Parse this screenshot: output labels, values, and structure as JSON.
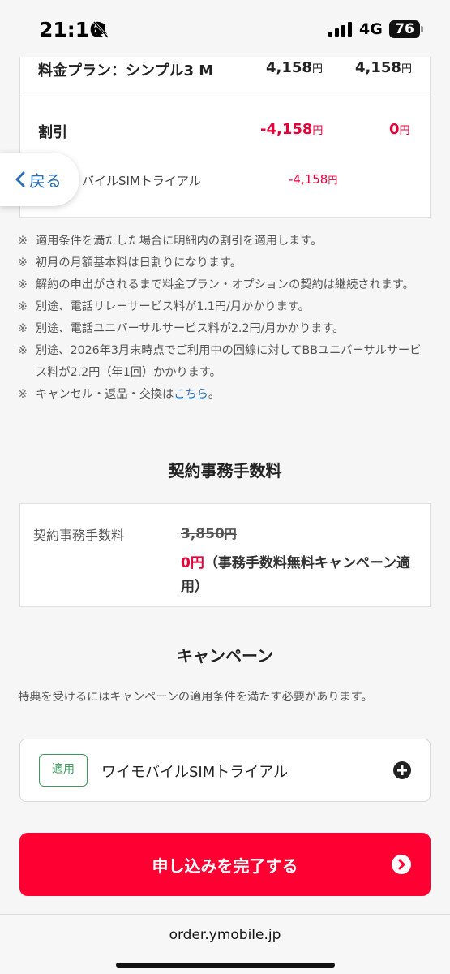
{
  "status_bar": {
    "time": "21:16",
    "network": "4G",
    "battery": "76"
  },
  "fee_table": {
    "plan_label": "料金プラン：シンプル3 M",
    "plan_first": "4,158",
    "plan_second": "4,158",
    "discount_label": "割引",
    "discount_first": "-4,158",
    "discount_second": "0",
    "trial_label": "バイルSIMトライアル",
    "trial_value": "-4,158",
    "yen": "円"
  },
  "back_button": {
    "label": "戻る"
  },
  "notes": {
    "mark": "※",
    "items": [
      "適用条件を満たした場合に明細内の割引を適用します。",
      "初月の月額基本料は日割りになります。",
      "解約の申出がされるまで料金プラン・オプションの契約は継続されます。",
      "別途、電話リレーサービス料が1.1円/月かかります。",
      "別途、電話ユニバーサルサービス料が2.2円/月かかります。",
      "別途、2026年3月末時点でご利用中の回線に対してBBユニバーサルサービス料が2.2円（年1回）かかります。"
    ],
    "last_prefix": "キャンセル・返品・交換は",
    "last_link": "こちら",
    "last_suffix": "。"
  },
  "contract_section": {
    "title": "契約事務手数料",
    "label": "契約事務手数料",
    "original_price": "3,850",
    "free_price": "0円",
    "free_note": "（事務手数料無料キャンペーン適用）"
  },
  "campaign_section": {
    "title": "キャンペーン",
    "description": "特典を受けるにはキャンペーンの適用条件を満たす必要があります。",
    "badge": "適用",
    "name": "ワイモバイルSIMトライアル"
  },
  "submit": {
    "label": "申し込みを完了する"
  },
  "browser": {
    "url": "order.ymobile.jp"
  },
  "colors": {
    "accent_red": "#e6003a",
    "button_red": "#ff0033",
    "link_blue": "#2a6fb5",
    "badge_green": "#3a9b5c"
  }
}
